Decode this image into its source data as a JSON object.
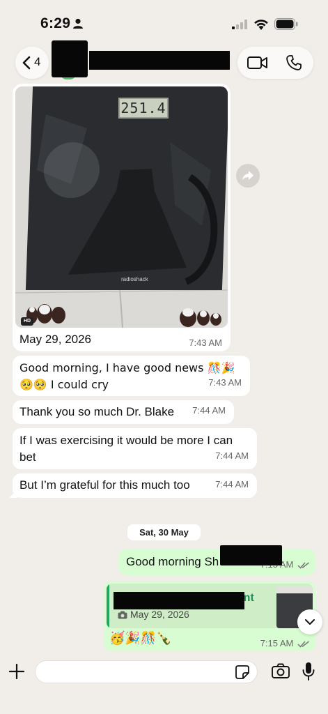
{
  "status_bar": {
    "time": "6:29"
  },
  "header": {
    "back_count": "4"
  },
  "photo_message": {
    "scale_reading": "251.4",
    "scale_brand": "radioshack",
    "hd_badge": "HD",
    "caption": "May 29, 2026",
    "time": "7:43 AM"
  },
  "incoming_messages": [
    {
      "text_line1": "Good morning, I have good news 🎊🎉",
      "text_line2": "🥺🥺 I could cry",
      "time": "7:43 AM"
    },
    {
      "text": "Thank you so much Dr. Blake",
      "time": "7:44 AM"
    },
    {
      "text_line1": "If I was exercising it would be more I can",
      "text_line2": "bet",
      "time": "7:44 AM"
    },
    {
      "text": "But I’m grateful for this much too",
      "time": "7:44 AM"
    }
  ],
  "day_divider": "Sat, 30 May",
  "outgoing_messages": [
    {
      "text": "Good morning Sh",
      "time": "7:15 AM"
    },
    {
      "quote_name": "tient",
      "quote_caption": "May 29, 2026",
      "emojis": "🥳🎉🎊🍾",
      "time": "7:15 AM"
    }
  ],
  "composer": {
    "placeholder": "",
    "value": ""
  },
  "colors": {
    "background": "#f1eee9",
    "incoming_bubble": "#ffffff",
    "outgoing_bubble": "#d9fdd3",
    "accent_green": "#1f8f57"
  },
  "icons": [
    "person-icon",
    "cellular-signal-icon",
    "wifi-icon",
    "battery-icon",
    "back-chevron-icon",
    "video-call-icon",
    "phone-call-icon",
    "forward-icon",
    "camera-small-icon",
    "double-check-icon",
    "chevron-down-icon",
    "plus-icon",
    "sticker-icon",
    "camera-icon",
    "microphone-icon"
  ]
}
